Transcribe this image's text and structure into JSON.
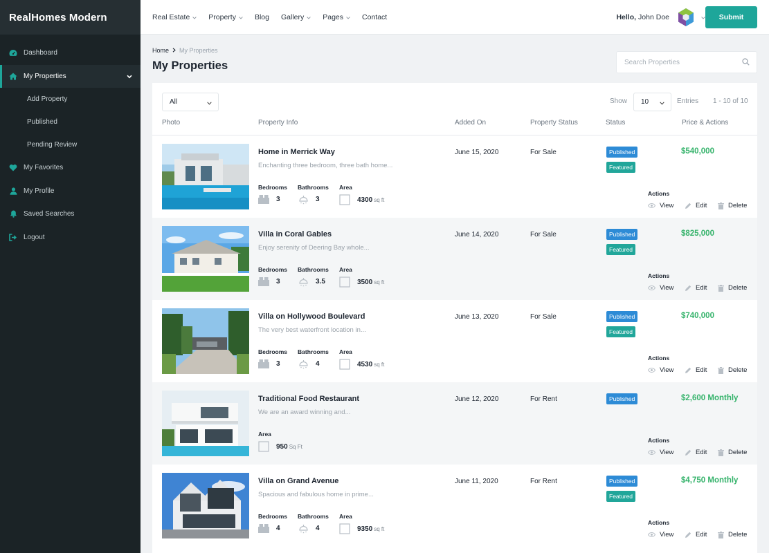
{
  "brand": "RealHomes Modern",
  "sidebar": {
    "items": [
      {
        "label": "Dashboard",
        "icon": "dashboard-icon"
      },
      {
        "label": "My Properties",
        "icon": "home-icon",
        "active": true
      },
      {
        "label": "My Favorites",
        "icon": "heart-icon"
      },
      {
        "label": "My Profile",
        "icon": "user-icon"
      },
      {
        "label": "Saved Searches",
        "icon": "bell-icon"
      },
      {
        "label": "Logout",
        "icon": "logout-icon"
      }
    ],
    "subitems": [
      "Add Property",
      "Published",
      "Pending Review"
    ]
  },
  "header": {
    "menu": [
      {
        "label": "Real Estate",
        "dropdown": true
      },
      {
        "label": "Property",
        "dropdown": true
      },
      {
        "label": "Blog",
        "dropdown": false
      },
      {
        "label": "Gallery",
        "dropdown": true
      },
      {
        "label": "Pages",
        "dropdown": true
      },
      {
        "label": "Contact",
        "dropdown": false
      }
    ],
    "greeting": "Hello,",
    "user_name": "John Doe",
    "submit_label": "Submit"
  },
  "breadcrumb": {
    "home": "Home",
    "current": "My Properties"
  },
  "page_title": "My Properties",
  "search": {
    "placeholder": "Search Properties"
  },
  "toolbar": {
    "filter_value": "All",
    "show_label": "Show",
    "show_value": "10",
    "entries_label": "Entries",
    "range": "1 - 10 of 10"
  },
  "table": {
    "headers": [
      "Photo",
      "Property Info",
      "Added On",
      "Property Status",
      "Status",
      "Price & Actions"
    ],
    "labels": {
      "bedrooms": "Bedrooms",
      "bathrooms": "Bathrooms",
      "area": "Area",
      "actions": "Actions",
      "view": "View",
      "edit": "Edit",
      "delete": "Delete"
    },
    "rows": [
      {
        "title": "Home in Merrick Way",
        "desc": "Enchanting three bedroom, three bath home...",
        "bedrooms": "3",
        "bathrooms": "3",
        "area": "4300",
        "area_unit": "sq ft",
        "added": "June 15, 2020",
        "status": "For Sale",
        "published": "Published",
        "featured": "Featured",
        "price": "$540,000"
      },
      {
        "title": "Villa in Coral Gables",
        "desc": "Enjoy serenity of Deering Bay whole...",
        "bedrooms": "3",
        "bathrooms": "3.5",
        "area": "3500",
        "area_unit": "sq ft",
        "added": "June 14, 2020",
        "status": "For Sale",
        "published": "Published",
        "featured": "Featured",
        "price": "$825,000"
      },
      {
        "title": "Villa on Hollywood Boulevard",
        "desc": "The very best waterfront location in...",
        "bedrooms": "3",
        "bathrooms": "4",
        "area": "4530",
        "area_unit": "sq ft",
        "added": "June 13, 2020",
        "status": "For Sale",
        "published": "Published",
        "featured": "Featured",
        "price": "$740,000"
      },
      {
        "title": "Traditional Food Restaurant",
        "desc": "We are an award winning and...",
        "area": "950",
        "area_unit": "Sq Ft",
        "added": "June 12, 2020",
        "status": "For Rent",
        "published": "Published",
        "price": "$2,600 Monthly"
      },
      {
        "title": "Villa on Grand Avenue",
        "desc": "Spacious and fabulous home in prime...",
        "bedrooms": "4",
        "bathrooms": "4",
        "area": "9350",
        "area_unit": "sq ft",
        "added": "June 11, 2020",
        "status": "For Rent",
        "published": "Published",
        "featured": "Featured",
        "price": "$4,750 Monthly"
      }
    ]
  },
  "colors": {
    "accent": "#1ea69a",
    "sidebar_bg": "#1b2326",
    "published": "#2d8bd6",
    "featured": "#21a69a",
    "price": "#35b36b"
  }
}
